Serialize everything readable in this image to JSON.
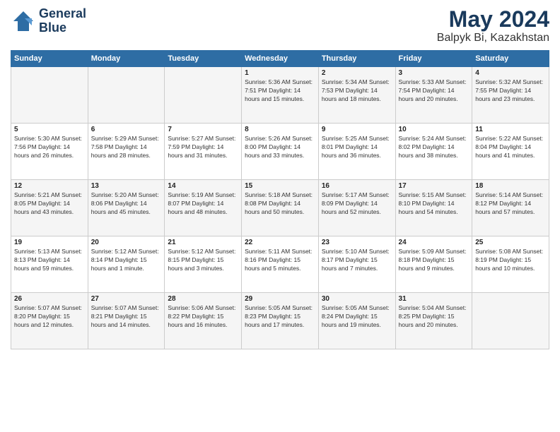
{
  "app": {
    "logo_line1": "General",
    "logo_line2": "Blue"
  },
  "title": {
    "month_year": "May 2024",
    "location": "Balpyk Bi, Kazakhstan"
  },
  "days_header": [
    "Sunday",
    "Monday",
    "Tuesday",
    "Wednesday",
    "Thursday",
    "Friday",
    "Saturday"
  ],
  "weeks": [
    [
      {
        "day": "",
        "info": ""
      },
      {
        "day": "",
        "info": ""
      },
      {
        "day": "",
        "info": ""
      },
      {
        "day": "1",
        "info": "Sunrise: 5:36 AM\nSunset: 7:51 PM\nDaylight: 14 hours\nand 15 minutes."
      },
      {
        "day": "2",
        "info": "Sunrise: 5:34 AM\nSunset: 7:53 PM\nDaylight: 14 hours\nand 18 minutes."
      },
      {
        "day": "3",
        "info": "Sunrise: 5:33 AM\nSunset: 7:54 PM\nDaylight: 14 hours\nand 20 minutes."
      },
      {
        "day": "4",
        "info": "Sunrise: 5:32 AM\nSunset: 7:55 PM\nDaylight: 14 hours\nand 23 minutes."
      }
    ],
    [
      {
        "day": "5",
        "info": "Sunrise: 5:30 AM\nSunset: 7:56 PM\nDaylight: 14 hours\nand 26 minutes."
      },
      {
        "day": "6",
        "info": "Sunrise: 5:29 AM\nSunset: 7:58 PM\nDaylight: 14 hours\nand 28 minutes."
      },
      {
        "day": "7",
        "info": "Sunrise: 5:27 AM\nSunset: 7:59 PM\nDaylight: 14 hours\nand 31 minutes."
      },
      {
        "day": "8",
        "info": "Sunrise: 5:26 AM\nSunset: 8:00 PM\nDaylight: 14 hours\nand 33 minutes."
      },
      {
        "day": "9",
        "info": "Sunrise: 5:25 AM\nSunset: 8:01 PM\nDaylight: 14 hours\nand 36 minutes."
      },
      {
        "day": "10",
        "info": "Sunrise: 5:24 AM\nSunset: 8:02 PM\nDaylight: 14 hours\nand 38 minutes."
      },
      {
        "day": "11",
        "info": "Sunrise: 5:22 AM\nSunset: 8:04 PM\nDaylight: 14 hours\nand 41 minutes."
      }
    ],
    [
      {
        "day": "12",
        "info": "Sunrise: 5:21 AM\nSunset: 8:05 PM\nDaylight: 14 hours\nand 43 minutes."
      },
      {
        "day": "13",
        "info": "Sunrise: 5:20 AM\nSunset: 8:06 PM\nDaylight: 14 hours\nand 45 minutes."
      },
      {
        "day": "14",
        "info": "Sunrise: 5:19 AM\nSunset: 8:07 PM\nDaylight: 14 hours\nand 48 minutes."
      },
      {
        "day": "15",
        "info": "Sunrise: 5:18 AM\nSunset: 8:08 PM\nDaylight: 14 hours\nand 50 minutes."
      },
      {
        "day": "16",
        "info": "Sunrise: 5:17 AM\nSunset: 8:09 PM\nDaylight: 14 hours\nand 52 minutes."
      },
      {
        "day": "17",
        "info": "Sunrise: 5:15 AM\nSunset: 8:10 PM\nDaylight: 14 hours\nand 54 minutes."
      },
      {
        "day": "18",
        "info": "Sunrise: 5:14 AM\nSunset: 8:12 PM\nDaylight: 14 hours\nand 57 minutes."
      }
    ],
    [
      {
        "day": "19",
        "info": "Sunrise: 5:13 AM\nSunset: 8:13 PM\nDaylight: 14 hours\nand 59 minutes."
      },
      {
        "day": "20",
        "info": "Sunrise: 5:12 AM\nSunset: 8:14 PM\nDaylight: 15 hours\nand 1 minute."
      },
      {
        "day": "21",
        "info": "Sunrise: 5:12 AM\nSunset: 8:15 PM\nDaylight: 15 hours\nand 3 minutes."
      },
      {
        "day": "22",
        "info": "Sunrise: 5:11 AM\nSunset: 8:16 PM\nDaylight: 15 hours\nand 5 minutes."
      },
      {
        "day": "23",
        "info": "Sunrise: 5:10 AM\nSunset: 8:17 PM\nDaylight: 15 hours\nand 7 minutes."
      },
      {
        "day": "24",
        "info": "Sunrise: 5:09 AM\nSunset: 8:18 PM\nDaylight: 15 hours\nand 9 minutes."
      },
      {
        "day": "25",
        "info": "Sunrise: 5:08 AM\nSunset: 8:19 PM\nDaylight: 15 hours\nand 10 minutes."
      }
    ],
    [
      {
        "day": "26",
        "info": "Sunrise: 5:07 AM\nSunset: 8:20 PM\nDaylight: 15 hours\nand 12 minutes."
      },
      {
        "day": "27",
        "info": "Sunrise: 5:07 AM\nSunset: 8:21 PM\nDaylight: 15 hours\nand 14 minutes."
      },
      {
        "day": "28",
        "info": "Sunrise: 5:06 AM\nSunset: 8:22 PM\nDaylight: 15 hours\nand 16 minutes."
      },
      {
        "day": "29",
        "info": "Sunrise: 5:05 AM\nSunset: 8:23 PM\nDaylight: 15 hours\nand 17 minutes."
      },
      {
        "day": "30",
        "info": "Sunrise: 5:05 AM\nSunset: 8:24 PM\nDaylight: 15 hours\nand 19 minutes."
      },
      {
        "day": "31",
        "info": "Sunrise: 5:04 AM\nSunset: 8:25 PM\nDaylight: 15 hours\nand 20 minutes."
      },
      {
        "day": "",
        "info": ""
      }
    ]
  ]
}
